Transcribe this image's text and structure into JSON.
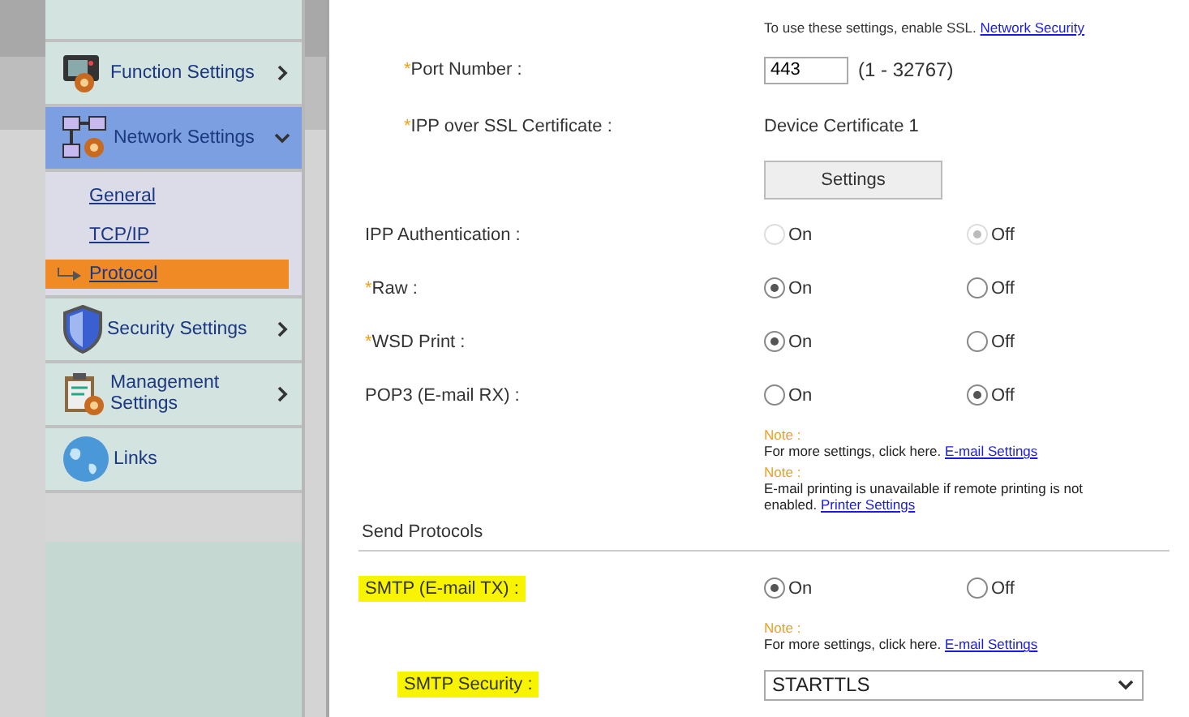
{
  "sidebar": {
    "items": [
      {
        "label": "Function Settings",
        "expanded": false,
        "selected": false,
        "chevron": true
      },
      {
        "label": "Network Settings",
        "expanded": true,
        "selected": true,
        "chevron": true,
        "children": [
          {
            "label": "General",
            "selected": false
          },
          {
            "label": "TCP/IP",
            "selected": false
          },
          {
            "label": "Protocol",
            "selected": true
          }
        ]
      },
      {
        "label": "Security Settings",
        "expanded": false,
        "selected": false,
        "chevron": true
      },
      {
        "label": "Management Settings",
        "expanded": false,
        "selected": false,
        "chevron": true
      },
      {
        "label": "Links",
        "selected": false,
        "chevron": false
      }
    ]
  },
  "rows": [
    {
      "kind": "info",
      "text": "To use these settings, enable SSL.",
      "link": "Network Security"
    },
    {
      "kind": "field",
      "asterisk": "*",
      "label": "Port Number :",
      "value": "443",
      "range": "(1 - 32767)"
    },
    {
      "kind": "text",
      "asterisk": "*",
      "label": "IPP over SSL Certificate :",
      "value": "Device Certificate 1"
    },
    {
      "kind": "button",
      "text": "Settings"
    },
    {
      "kind": "radio",
      "label": "IPP Authentication :",
      "disabled": true,
      "highlighted": false,
      "options": [
        {
          "label": "On",
          "selected": false
        },
        {
          "label": "Off",
          "selected": true
        }
      ]
    },
    {
      "kind": "radio",
      "asterisk": "*",
      "label": "Raw :",
      "disabled": false,
      "highlighted": false,
      "options": [
        {
          "label": "On",
          "selected": true
        },
        {
          "label": "Off",
          "selected": false
        }
      ]
    },
    {
      "kind": "radio",
      "asterisk": "*",
      "label": "WSD Print :",
      "disabled": false,
      "highlighted": false,
      "options": [
        {
          "label": "On",
          "selected": true
        },
        {
          "label": "Off",
          "selected": false
        }
      ]
    },
    {
      "kind": "radio",
      "label": "POP3 (E-mail RX) :",
      "disabled": false,
      "highlighted": false,
      "options": [
        {
          "label": "On",
          "selected": false
        },
        {
          "label": "Off",
          "selected": true
        }
      ]
    },
    {
      "kind": "note",
      "title": "Note :",
      "text": "For more settings, click here.",
      "link": "E-mail Settings"
    },
    {
      "kind": "note",
      "title": "Note :",
      "text": "E-mail printing is unavailable if remote printing is not enabled.",
      "link": "Printer Settings"
    },
    {
      "kind": "section",
      "text": "Send Protocols"
    },
    {
      "kind": "radio",
      "label": "SMTP (E-mail TX) :",
      "disabled": false,
      "highlighted": true,
      "options": [
        {
          "label": "On",
          "selected": true
        },
        {
          "label": "Off",
          "selected": false
        }
      ]
    },
    {
      "kind": "note",
      "title": "Note :",
      "text": "For more settings, click here.",
      "link": "E-mail Settings"
    },
    {
      "kind": "select",
      "label": "SMTP Security :",
      "highlighted": true,
      "value": "STARTTLS"
    }
  ]
}
